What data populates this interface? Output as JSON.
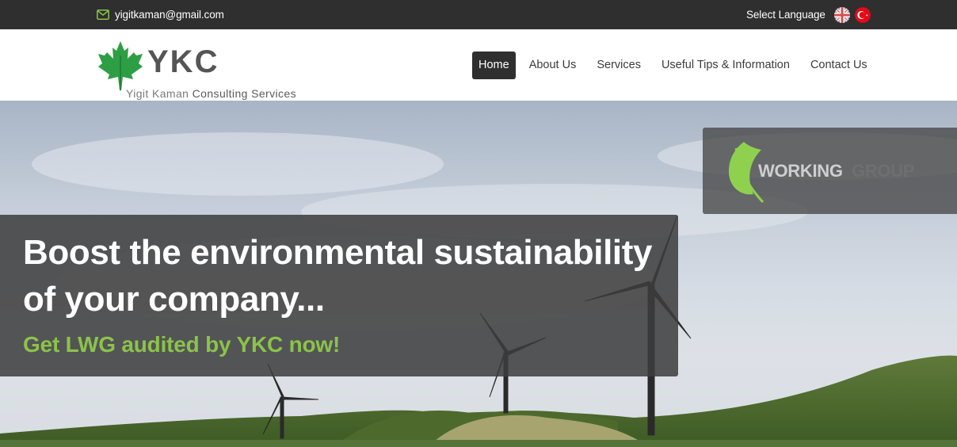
{
  "topbar": {
    "email": "yigitkaman@gmail.com",
    "email_icon": "envelope-icon",
    "language_label": "Select Language",
    "flags": [
      "uk-flag-icon",
      "turkey-flag-icon"
    ]
  },
  "logo": {
    "mark": "YKC",
    "tag_part1": "Yigit Kaman",
    "tag_part2": " Consulting Services",
    "icon": "maple-leaf-icon"
  },
  "nav": {
    "items": [
      {
        "label": "Home",
        "active": true
      },
      {
        "label": "About Us",
        "active": false
      },
      {
        "label": "Services",
        "active": false
      },
      {
        "label": "Useful Tips & Information",
        "active": false
      },
      {
        "label": "Contact Us",
        "active": false
      }
    ]
  },
  "hero": {
    "badge_word1": "WORKING",
    "badge_word2": "GROUP",
    "headline": "Boost the environmental sustainability of your company...",
    "subline": "Get LWG audited by YKC now!"
  },
  "colors": {
    "topbar": "#2f2f2f",
    "accent_green": "#8bc34a",
    "leaf_green": "#2e9e45",
    "active_nav": "#2f2f2f"
  }
}
